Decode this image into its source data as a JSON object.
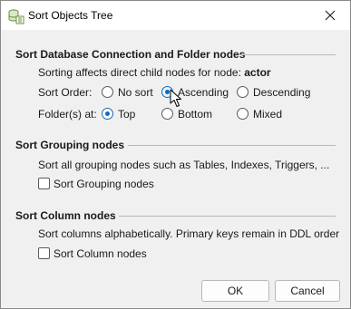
{
  "window": {
    "title": "Sort Objects Tree",
    "icon": "sort-tree-icon"
  },
  "section1": {
    "title": "Sort Database Connection and Folder nodes",
    "info_prefix": "Sorting affects direct child nodes for node: ",
    "info_node": "actor",
    "sort_order_label": "Sort Order:",
    "sort_order_options": [
      "No sort",
      "Ascending",
      "Descending"
    ],
    "sort_order_selected": "Ascending",
    "folders_label": "Folder(s) at:",
    "folders_options": [
      "Top",
      "Bottom",
      "Mixed"
    ],
    "folders_selected": "Top"
  },
  "section2": {
    "title": "Sort Grouping nodes",
    "info": "Sort all grouping nodes such as Tables, Indexes, Triggers, ...",
    "checkbox_label": "Sort Grouping nodes",
    "checked": false
  },
  "section3": {
    "title": "Sort Column nodes",
    "info": "Sort columns alphabetically. Primary keys remain in DDL order",
    "checkbox_label": "Sort Column nodes",
    "checked": false
  },
  "buttons": {
    "ok": "OK",
    "cancel": "Cancel"
  },
  "colors": {
    "accent": "#0f6cbd"
  }
}
